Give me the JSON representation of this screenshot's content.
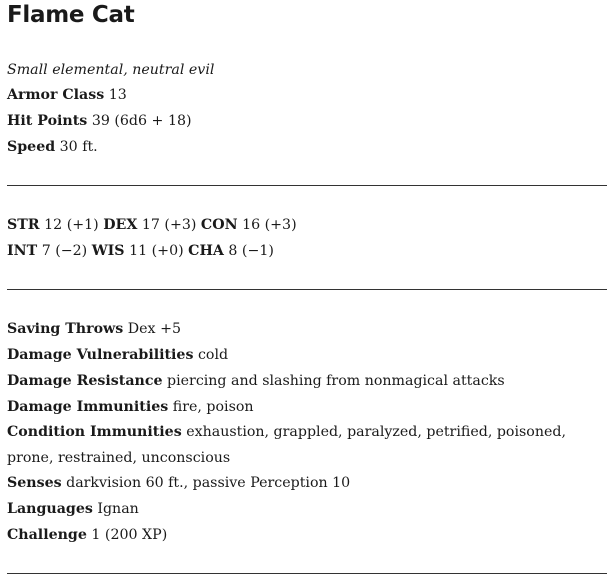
{
  "title": "Flame Cat",
  "meta": "Small elemental, neutral evil",
  "basics": {
    "ac_label": "Armor Class",
    "ac_value": "13",
    "hp_label": "Hit Points",
    "hp_value": "39 (6d6 + 18)",
    "speed_label": "Speed",
    "speed_value": "30 ft."
  },
  "abilities": {
    "str_label": "STR",
    "str_value": "12 (+1)",
    "dex_label": "DEX",
    "dex_value": "17 (+3)",
    "con_label": "CON",
    "con_value": "16 (+3)",
    "int_label": "INT",
    "int_value": "7 (−2)",
    "wis_label": "WIS",
    "wis_value": "11 (+0)",
    "cha_label": "CHA",
    "cha_value": "8 (−1)"
  },
  "details": {
    "saving_label": "Saving Throws",
    "saving_value": "Dex +5",
    "vuln_label": "Damage Vulnerabilities",
    "vuln_value": "cold",
    "resist_label": "Damage Resistance",
    "resist_value": "piercing and slashing from nonmagical attacks",
    "immune_label": "Damage Immunities",
    "immune_value": "fire, poison",
    "cond_label": "Condition Immunities",
    "cond_value": "exhaustion, grappled, paralyzed, petrified, poisoned, prone, restrained, unconscious",
    "senses_label": "Senses",
    "senses_value": "darkvision 60 ft., passive Perception 10",
    "lang_label": "Languages",
    "lang_value": "Ignan",
    "challenge_label": "Challenge",
    "challenge_value": "1 (200 XP)"
  }
}
